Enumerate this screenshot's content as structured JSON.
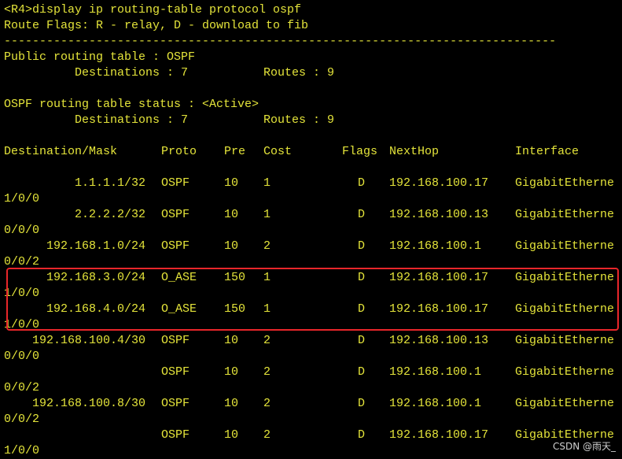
{
  "terminal": {
    "command": "<R4>display ip routing-table protocol ospf",
    "route_flags": "Route Flags: R - relay, D - download to fib",
    "separator": "------------------------------------------------------------------------------",
    "public_table": {
      "title": "Public routing table : OSPF",
      "destinations_label": "Destinations : 7",
      "routes_label": "Routes : 9"
    },
    "ospf_status": {
      "title": "OSPF routing table status : <Active>",
      "destinations_label": "Destinations : 7",
      "routes_label": "Routes : 9"
    },
    "columns": {
      "destination": "Destination/Mask",
      "proto": "Proto",
      "pre": "Pre",
      "cost": "Cost",
      "flags": "Flags",
      "nexthop": "NextHop",
      "interface": "Interface"
    },
    "rows": [
      {
        "destination": "1.1.1.1/32",
        "proto": "OSPF",
        "pre": "10",
        "cost": "1",
        "flags": "D",
        "nexthop": "192.168.100.17",
        "interface": "GigabitEtherne",
        "wrap": "1/0/0"
      },
      {
        "destination": "2.2.2.2/32",
        "proto": "OSPF",
        "pre": "10",
        "cost": "1",
        "flags": "D",
        "nexthop": "192.168.100.13",
        "interface": "GigabitEtherne",
        "wrap": "0/0/0"
      },
      {
        "destination": "192.168.1.0/24",
        "proto": "OSPF",
        "pre": "10",
        "cost": "2",
        "flags": "D",
        "nexthop": "192.168.100.1",
        "interface": "GigabitEtherne",
        "wrap": "0/0/2"
      },
      {
        "destination": "192.168.3.0/24",
        "proto": "O_ASE",
        "pre": "150",
        "cost": "1",
        "flags": "D",
        "nexthop": "192.168.100.17",
        "interface": "GigabitEtherne",
        "wrap": "1/0/0"
      },
      {
        "destination": "192.168.4.0/24",
        "proto": "O_ASE",
        "pre": "150",
        "cost": "1",
        "flags": "D",
        "nexthop": "192.168.100.17",
        "interface": "GigabitEtherne",
        "wrap": "1/0/0"
      },
      {
        "destination": "192.168.100.4/30",
        "proto": "OSPF",
        "pre": "10",
        "cost": "2",
        "flags": "D",
        "nexthop": "192.168.100.13",
        "interface": "GigabitEtherne",
        "wrap": "0/0/0"
      },
      {
        "destination": "",
        "proto": "OSPF",
        "pre": "10",
        "cost": "2",
        "flags": "D",
        "nexthop": "192.168.100.1",
        "interface": "GigabitEtherne",
        "wrap": "0/0/2"
      },
      {
        "destination": "192.168.100.8/30",
        "proto": "OSPF",
        "pre": "10",
        "cost": "2",
        "flags": "D",
        "nexthop": "192.168.100.1",
        "interface": "GigabitEtherne",
        "wrap": "0/0/2"
      },
      {
        "destination": "",
        "proto": "OSPF",
        "pre": "10",
        "cost": "2",
        "flags": "D",
        "nexthop": "192.168.100.17",
        "interface": "GigabitEtherne",
        "wrap": "1/0/0"
      }
    ]
  },
  "colors": {
    "background": "#000000",
    "text": "#e4e43a",
    "highlight_border": "#e8262a"
  },
  "watermark": "CSDN @雨天_"
}
